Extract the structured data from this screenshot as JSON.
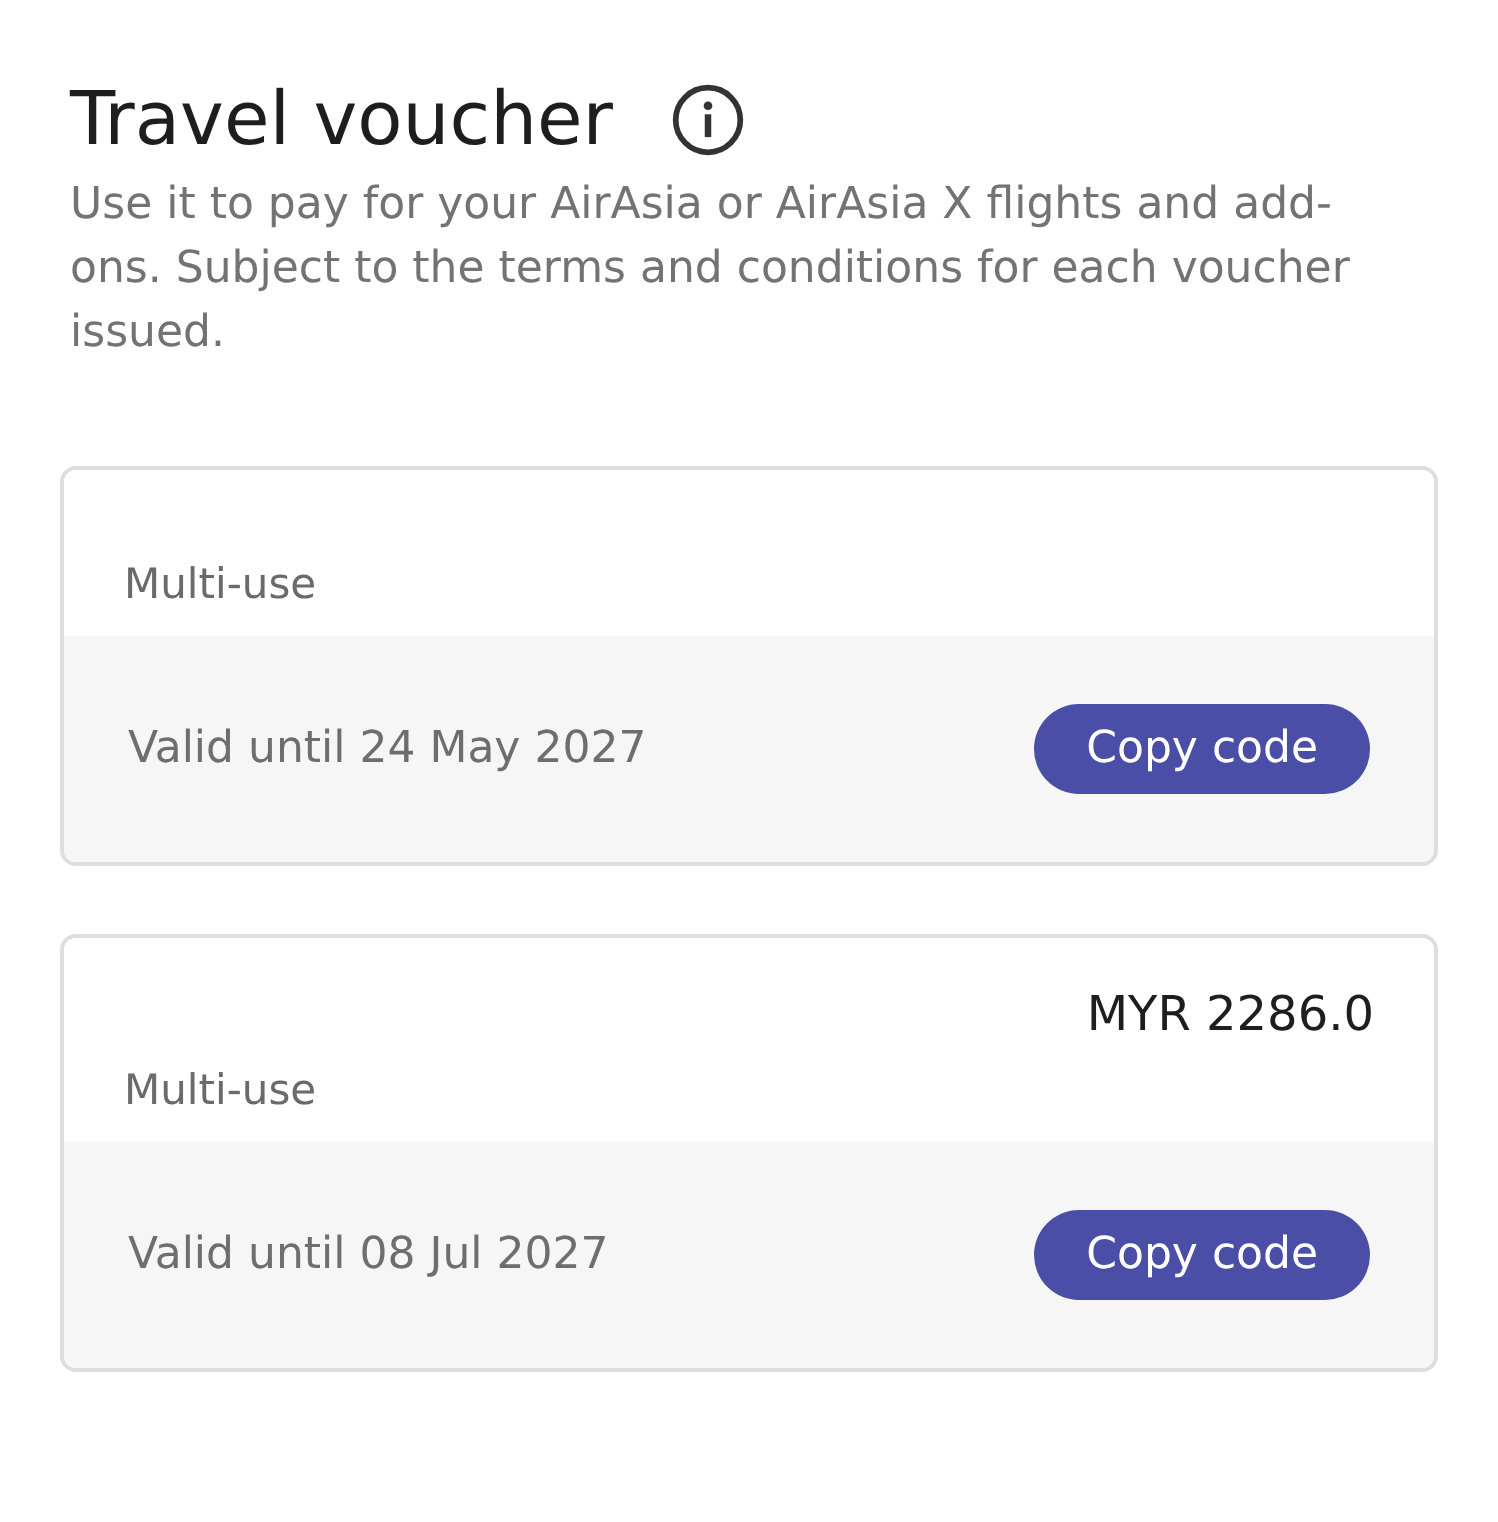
{
  "header": {
    "title": "Travel voucher",
    "description": "Use it to pay for your AirAsia or AirAsia X flights and add-ons. Subject to the terms and conditions for each voucher issued."
  },
  "vouchers": [
    {
      "type": "Multi-use",
      "validity": "Valid until 24 May 2027",
      "button": "Copy code"
    },
    {
      "amount": "MYR 2286.0",
      "type": "Multi-use",
      "validity": "Valid until 08 Jul 2027",
      "button": "Copy code"
    }
  ]
}
